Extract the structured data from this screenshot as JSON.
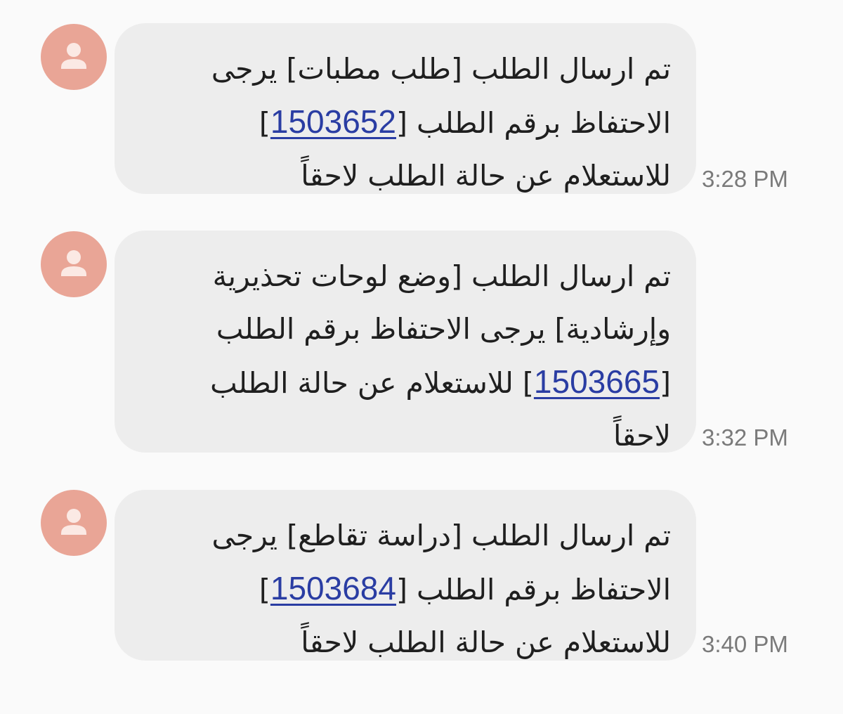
{
  "messages": [
    {
      "lines": [
        {
          "before": "تم ارسال الطلب [طلب مطبات] يرجى"
        },
        {
          "before": "الاحتفاظ  برقم الطلب [",
          "number": "1503652",
          "after": "]"
        },
        {
          "before": "للاستعلام عن حالة الطلب لاحقاً"
        }
      ],
      "time": "3:28 PM"
    },
    {
      "lines": [
        {
          "before": "تم ارسال الطلب [وضع لوحات تحذيرية"
        },
        {
          "before": "وإرشادية] يرجى الاحتفاظ  برقم الطلب"
        },
        {
          "before": "[",
          "number": "1503665",
          "after": "] للاستعلام عن حالة الطلب"
        },
        {
          "before": "لاحقاً"
        }
      ],
      "time": "3:32 PM"
    },
    {
      "lines": [
        {
          "before": "تم ارسال الطلب [دراسة تقاطع] يرجى"
        },
        {
          "before": "الاحتفاظ  برقم الطلب [",
          "number": "1503684",
          "after": "]"
        },
        {
          "before": "للاستعلام عن حالة الطلب لاحقاً"
        }
      ],
      "time": "3:40 PM"
    }
  ],
  "colors": {
    "background": "#fafafa",
    "bubble": "#ededed",
    "avatar": "#e9a596",
    "link": "#2a3da3",
    "timestamp": "#7a7a7a"
  },
  "icons": {
    "avatar": "person-icon"
  }
}
